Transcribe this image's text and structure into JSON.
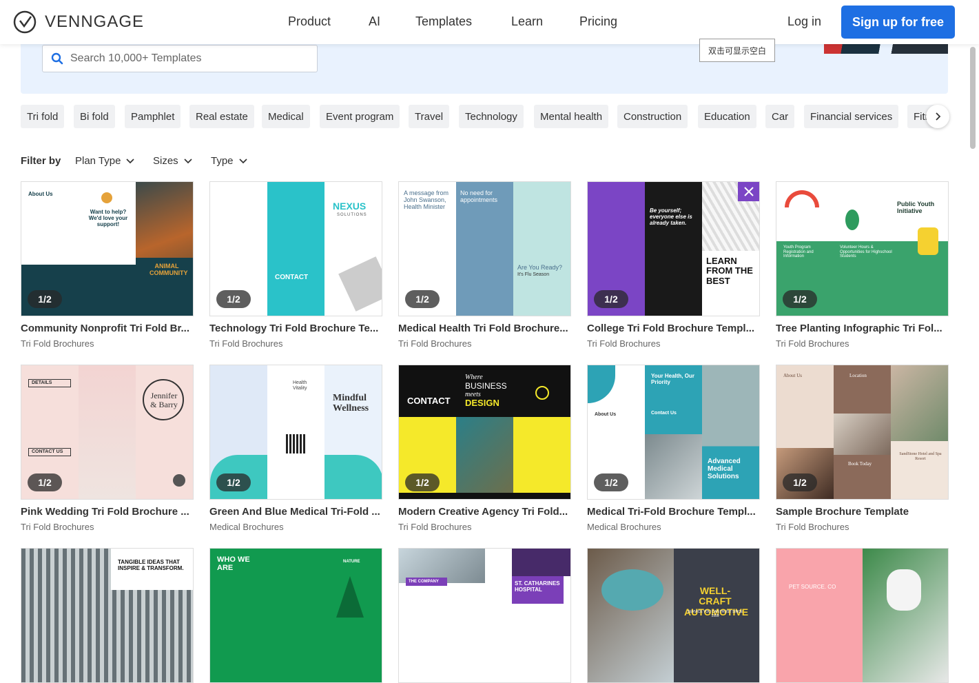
{
  "nav": {
    "brand": "VENNGAGE",
    "menu": [
      "Product",
      "AI",
      "Templates",
      "Learn",
      "Pricing"
    ],
    "login": "Log in",
    "signup": "Sign up for free"
  },
  "search": {
    "placeholder": "Search 10,000+ Templates"
  },
  "tooltip": "双击可显示空白",
  "chips": [
    "Tri fold",
    "Bi fold",
    "Pamphlet",
    "Real estate",
    "Medical",
    "Event program",
    "Travel",
    "Technology",
    "Mental health",
    "Construction",
    "Education",
    "Car",
    "Financial services",
    "Fitr"
  ],
  "filters": {
    "label": "Filter by",
    "items": [
      "Plan Type",
      "Sizes",
      "Type"
    ]
  },
  "cards": [
    {
      "title": "Community Nonprofit Tri Fold Br...",
      "sub": "Tri Fold Brochures",
      "pages": "1/2",
      "texts": [
        "About Us",
        "Want to help? We'd love your support!",
        "ANIMAL COMMUNITY"
      ]
    },
    {
      "title": "Technology Tri Fold Brochure Te...",
      "sub": "Tri Fold Brochures",
      "pages": "1/2",
      "texts": [
        "NEXUS",
        "SOLUTIONS",
        "CONTACT"
      ]
    },
    {
      "title": "Medical Health Tri Fold Brochure...",
      "sub": "Tri Fold Brochures",
      "pages": "1/2",
      "texts": [
        "A message from John Swanson, Health Minister",
        "No need for appointments",
        "Are You Ready?",
        "It's Flu Season"
      ]
    },
    {
      "title": "College Tri Fold Brochure Templ...",
      "sub": "Tri Fold Brochures",
      "pages": "1/2",
      "texts": [
        "Be yourself; everyone else is already taken.",
        "LEARN FROM THE BEST"
      ]
    },
    {
      "title": "Tree Planting Infographic Tri Fol...",
      "sub": "Tri Fold Brochures",
      "pages": "1/2",
      "texts": [
        "Public Youth Initiative",
        "Youth Program Registration and Information",
        "Volunteer Hours & Opportunities for Highschool Students"
      ]
    },
    {
      "title": "Pink Wedding Tri Fold Brochure ...",
      "sub": "Tri Fold Brochures",
      "pages": "1/2",
      "texts": [
        "DETAILS",
        "CONTACT US",
        "Jennifer & Barry"
      ]
    },
    {
      "title": "Green And Blue Medical Tri-Fold ...",
      "sub": "Medical Brochures",
      "pages": "1/2",
      "texts": [
        "Health Vitality",
        "Mindful Wellness"
      ]
    },
    {
      "title": "Modern Creative Agency Tri Fold...",
      "sub": "Tri Fold Brochures",
      "pages": "1/2",
      "texts": [
        "CONTACT",
        "Where",
        "BUSINESS",
        "meets",
        "DESIGN"
      ]
    },
    {
      "title": "Medical Tri-Fold Brochure Templ...",
      "sub": "Medical Brochures",
      "pages": "1/2",
      "texts": [
        "Your Health, Our Priority",
        "About Us",
        "Contact Us",
        "Advanced Medical Solutions"
      ]
    },
    {
      "title": "Sample Brochure Template",
      "sub": "Tri Fold Brochures",
      "pages": "1/2",
      "texts": [
        "About Us",
        "Location",
        "Book Today",
        "SandStone Hotel and Spa Resort"
      ]
    },
    {
      "texts": [
        "TANGIBLE IDEAS THAT INSPIRE & TRANSFORM."
      ]
    },
    {
      "texts": [
        "WHO WE ARE",
        "NATURE"
      ]
    },
    {
      "texts": [
        "THE COMPANY",
        "ST. CATHARINES HOSPITAL"
      ]
    },
    {
      "texts": [
        "WELL-CRAFT AUTOMOTIVE",
        "SERVICE YOU CAN TRUST SINCE 1999"
      ]
    },
    {
      "texts": [
        "PET SOURCE. CO"
      ]
    }
  ],
  "colors": {
    "accent": "#1e6fe3",
    "hero": "#e9f2fe"
  }
}
